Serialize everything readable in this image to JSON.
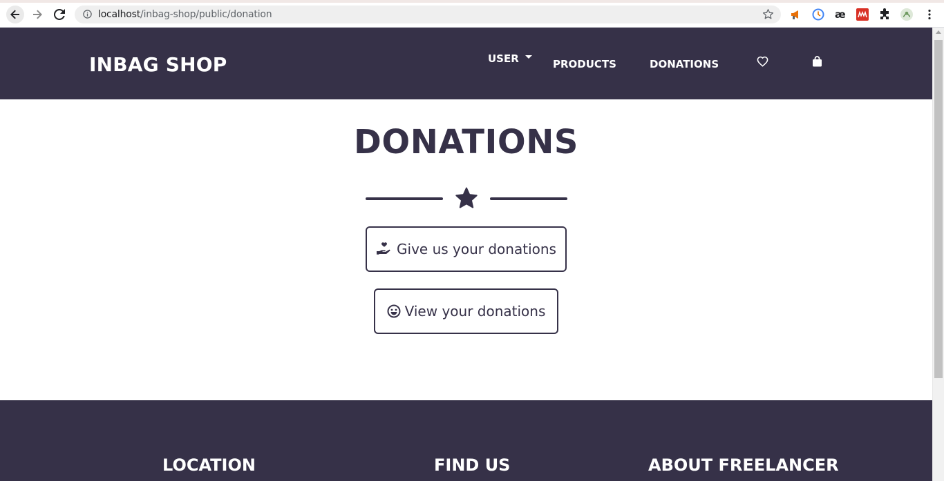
{
  "browser": {
    "url_host": "localhost",
    "url_path": "/inbag-shop/public/donation"
  },
  "header": {
    "brand": "INBAG SHOP",
    "nav": {
      "user": "USER",
      "products": "PRODUCTS",
      "donations": "DONATIONS"
    }
  },
  "main": {
    "title": "DONATIONS",
    "give_button": "Give us your donations",
    "view_button": "View your donations"
  },
  "footer": {
    "location": "LOCATION",
    "find_us": "FIND US",
    "about": "ABOUT FREELANCER"
  },
  "colors": {
    "primary": "#363148",
    "background": "#ffffff"
  }
}
